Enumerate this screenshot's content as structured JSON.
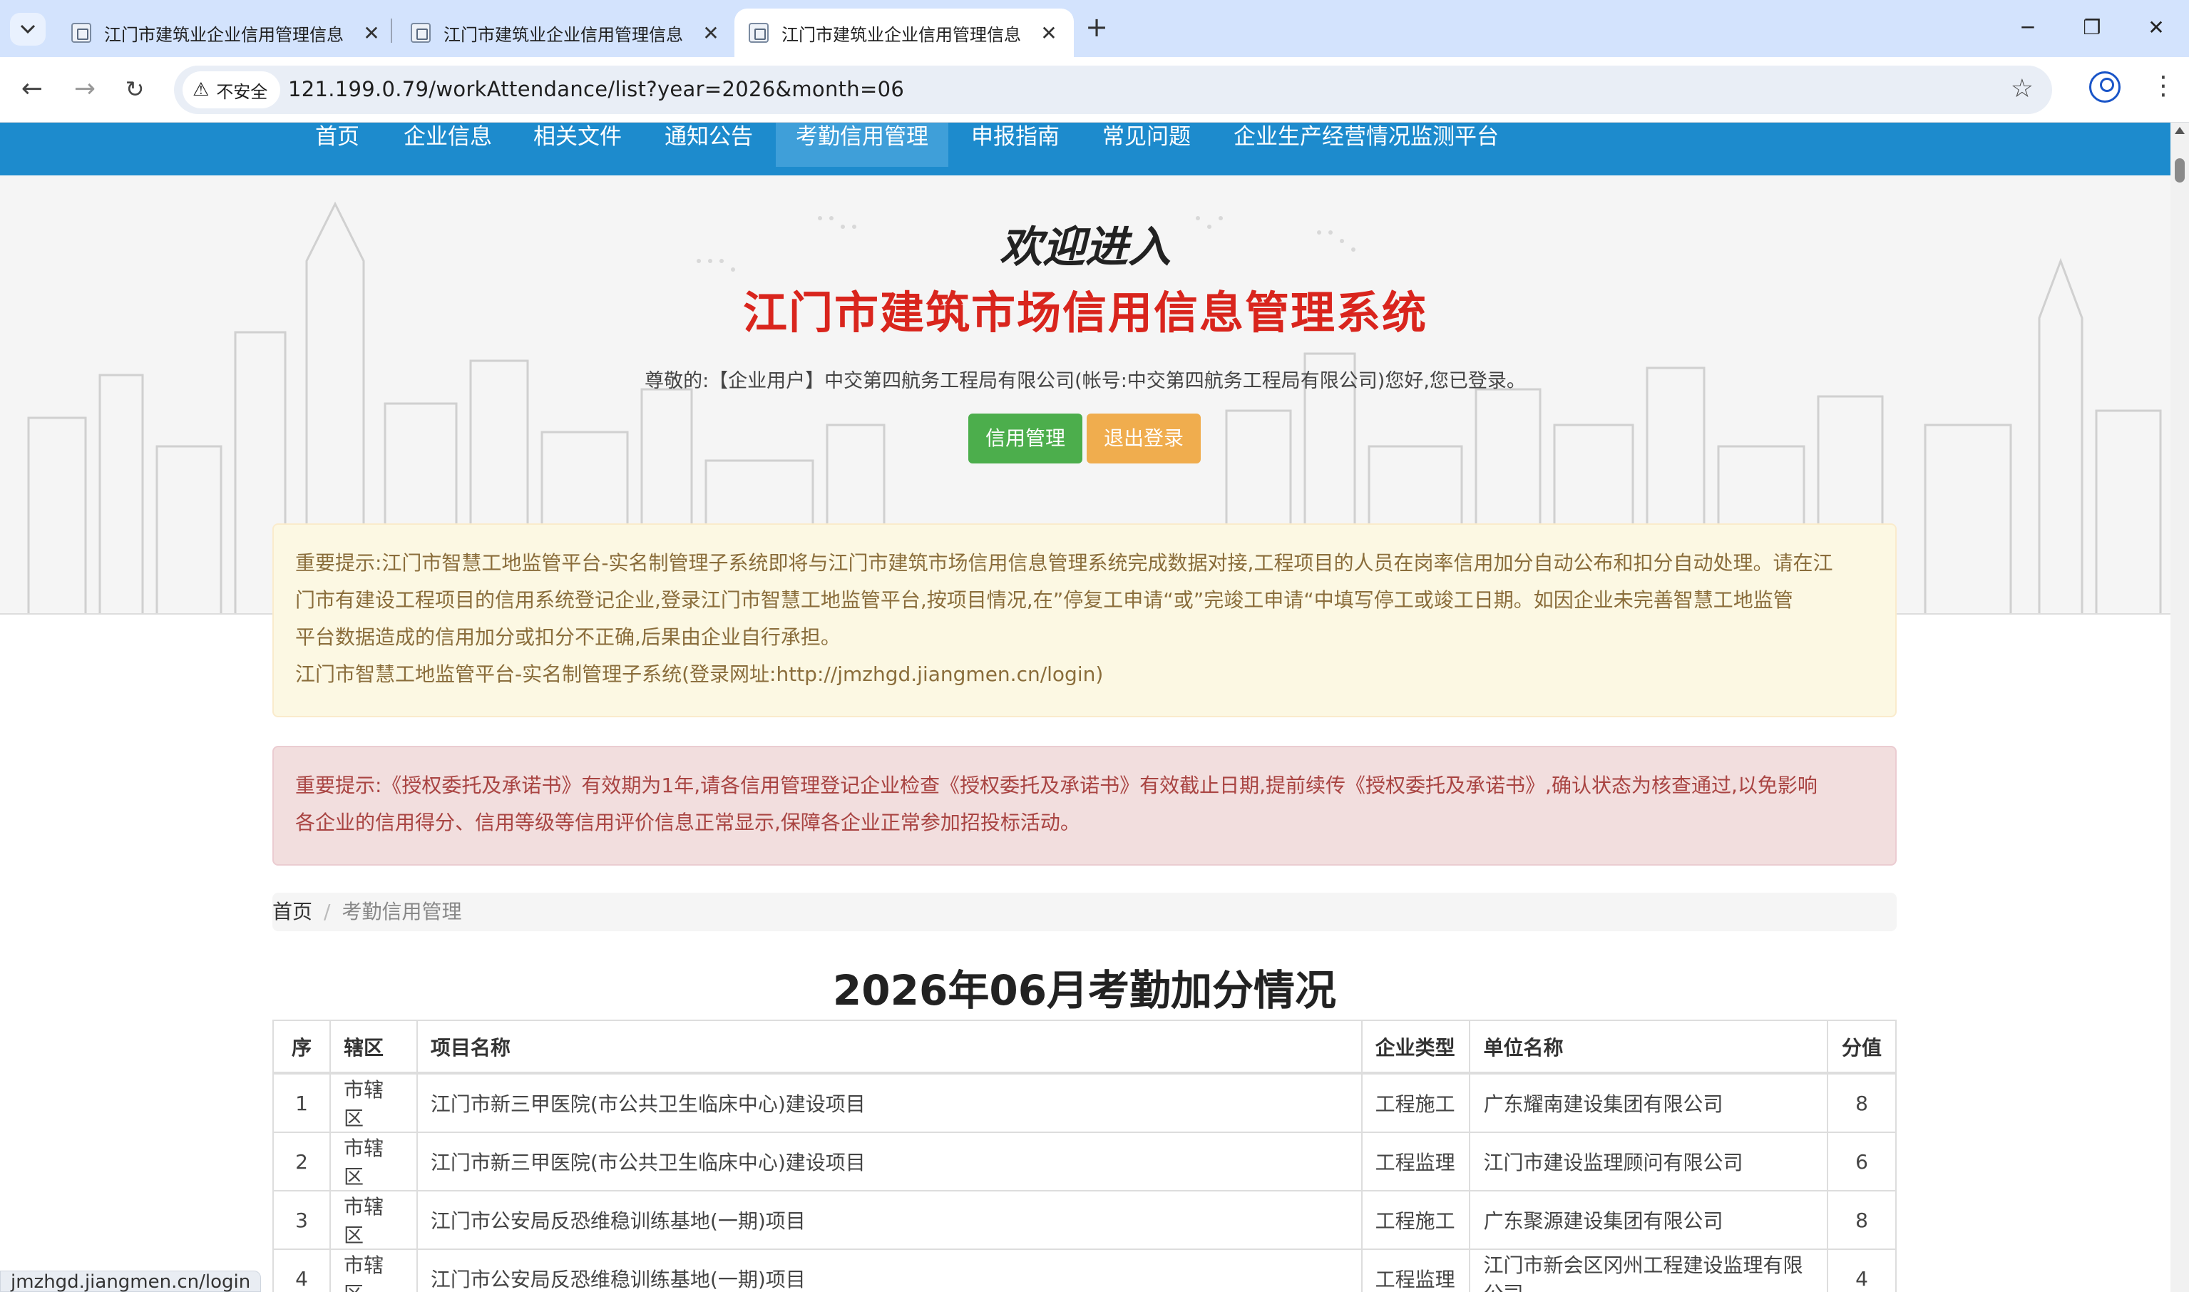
{
  "browser": {
    "tabs": [
      {
        "title": "江门市建筑业企业信用管理信息"
      },
      {
        "title": "江门市建筑业企业信用管理信息"
      },
      {
        "title": "江门市建筑业企业信用管理信息"
      }
    ],
    "security_label": "不安全",
    "url": "121.199.0.79/workAttendance/list?year=2026&month=06",
    "status_url": "jmzhgd.jiangmen.cn/login"
  },
  "nav": {
    "items": [
      "首页",
      "企业信息",
      "相关文件",
      "通知公告",
      "考勤信用管理",
      "申报指南",
      "常见问题",
      "企业生产经营情况监测平台"
    ],
    "active": "考勤信用管理"
  },
  "hero": {
    "welcome": "欢迎进入",
    "system_title": "江门市建筑市场信用信息管理系统",
    "greeting": "尊敬的:【企业用户】中交第四航务工程局有限公司(帐号:中交第四航务工程局有限公司)您好,您已登录。",
    "credit_button": "信用管理",
    "logout_button": "退出登录"
  },
  "notice_warning": {
    "line1": "重要提示:江门市智慧工地监管平台-实名制管理子系统即将与江门市建筑市场信用信息管理系统完成数据对接,工程项目的人员在岗率信用加分自动公布和扣分自动处理。请在江",
    "line2": "门市有建设工程项目的信用系统登记企业,登录江门市智慧工地监管平台,按项目情况,在”停复工申请“或”完竣工申请“中填写停工或竣工日期。如因企业未完善智慧工地监管",
    "line3": "平台数据造成的信用加分或扣分不正确,后果由企业自行承担。",
    "line4": "江门市智慧工地监管平台-实名制管理子系统(登录网址:http://jmzhgd.jiangmen.cn/login)"
  },
  "notice_danger": {
    "line1": "重要提示:《授权委托及承诺书》有效期为1年,请各信用管理登记企业检查《授权委托及承诺书》有效截止日期,提前续传《授权委托及承诺书》,确认状态为核查通过,以免影响",
    "line2": "各企业的信用得分、信用等级等信用评价信息正常显示,保障各企业正常参加招投标活动。"
  },
  "breadcrumb": {
    "home": "首页",
    "current": "考勤信用管理"
  },
  "page_title": "2026年06月考勤加分情况",
  "table": {
    "headers": [
      "序",
      "辖区",
      "项目名称",
      "企业类型",
      "单位名称",
      "分值"
    ],
    "rows": [
      {
        "no": "1",
        "district": "市辖区",
        "project": "江门市新三甲医院(市公共卫生临床中心)建设项目",
        "type": "工程施工",
        "company": "广东耀南建设集团有限公司",
        "score": "8"
      },
      {
        "no": "2",
        "district": "市辖区",
        "project": "江门市新三甲医院(市公共卫生临床中心)建设项目",
        "type": "工程监理",
        "company": "江门市建设监理顾问有限公司",
        "score": "6"
      },
      {
        "no": "3",
        "district": "市辖区",
        "project": "江门市公安局反恐维稳训练基地(一期)项目",
        "type": "工程施工",
        "company": "广东聚源建设集团有限公司",
        "score": "8"
      },
      {
        "no": "4",
        "district": "市辖区",
        "project": "江门市公安局反恐维稳训练基地(一期)项目",
        "type": "工程监理",
        "company": "江门市新会区冈州工程建设监理有限公司",
        "score": "4"
      }
    ]
  },
  "colors": {
    "nav_blue": "#1d8bcd",
    "title_red": "#d9251d",
    "btn_green": "#4cae4c",
    "btn_orange": "#f0ad4e"
  }
}
